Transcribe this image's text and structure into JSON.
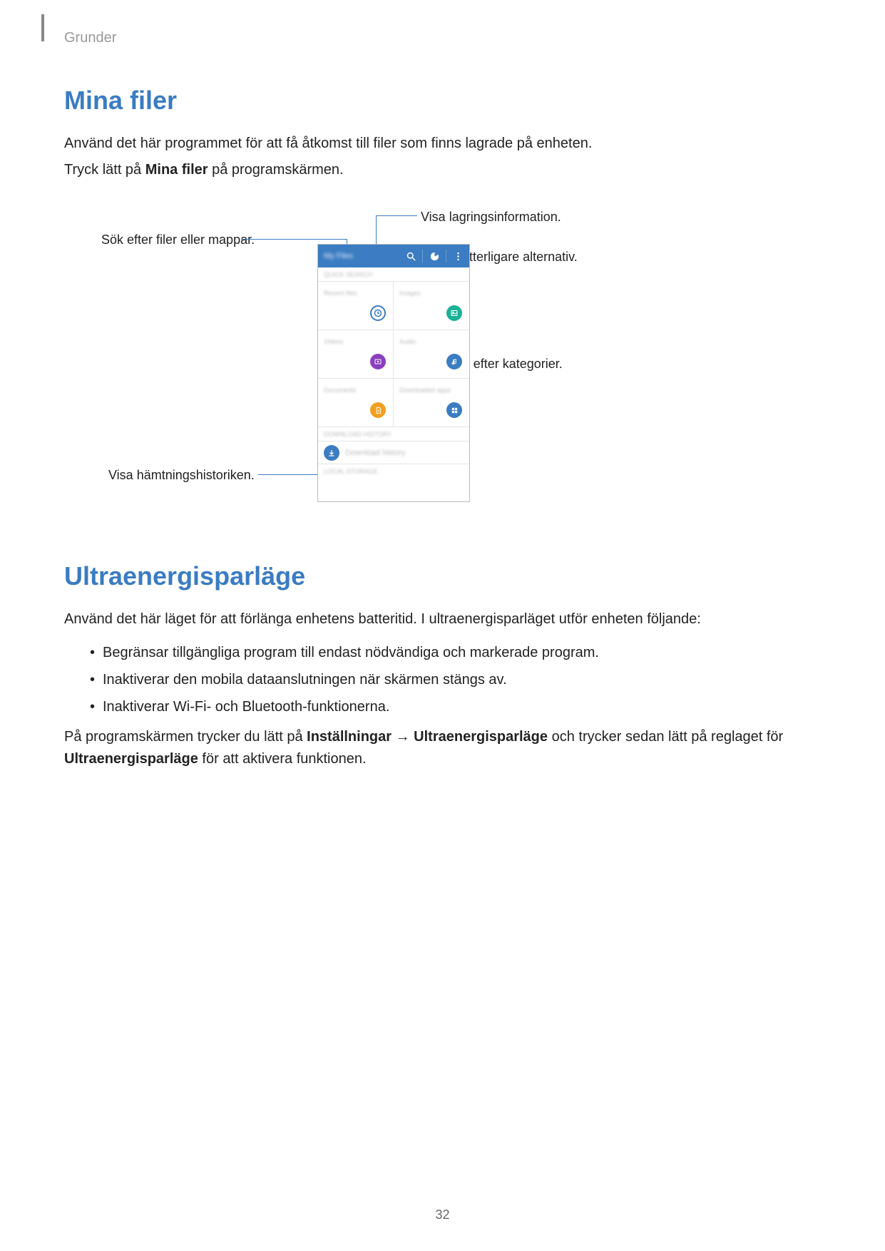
{
  "header": {
    "section": "Grunder"
  },
  "section1": {
    "title": "Mina filer",
    "para1": "Använd det här programmet för att få åtkomst till filer som finns lagrade på enheten.",
    "para2_pre": "Tryck lätt på ",
    "para2_bold": "Mina filer",
    "para2_post": " på programskärmen."
  },
  "callouts": {
    "search": "Sök efter filer eller mappar.",
    "storage": "Visa lagringsinformation.",
    "more": "Öppna ytterligare alternativ.",
    "categories": "Visa filer efter kategorier.",
    "downloads": "Visa hämtningshistoriken."
  },
  "phone": {
    "title": "My Files",
    "quick_search": "QUICK SEARCH",
    "tiles": {
      "recent": "Recent files",
      "images": "Images",
      "videos": "Videos",
      "audio": "Audio",
      "documents": "Documents",
      "downloaded": "Downloaded apps"
    },
    "download_history_header": "DOWNLOAD HISTORY",
    "download_history_item": "Download history",
    "local_storage": "LOCAL STORAGE"
  },
  "section2": {
    "title": "Ultraenergisparläge",
    "intro": "Använd det här läget för att förlänga enhetens batteritid. I ultraenergisparläget utför enheten följande:",
    "bullets": [
      "Begränsar tillgängliga program till endast nödvändiga och markerade program.",
      "Inaktiverar den mobila dataanslutningen när skärmen stängs av.",
      "Inaktiverar Wi-Fi- och Bluetooth-funktionerna."
    ],
    "closing_pre": "På programskärmen trycker du lätt på ",
    "closing_bold1": "Inställningar",
    "closing_arrow": " → ",
    "closing_bold2": "Ultraenergisparläge",
    "closing_mid": " och trycker sedan lätt på reglaget för ",
    "closing_bold3": "Ultraenergisparläge",
    "closing_post": " för att aktivera funktionen."
  },
  "page_number": "32"
}
